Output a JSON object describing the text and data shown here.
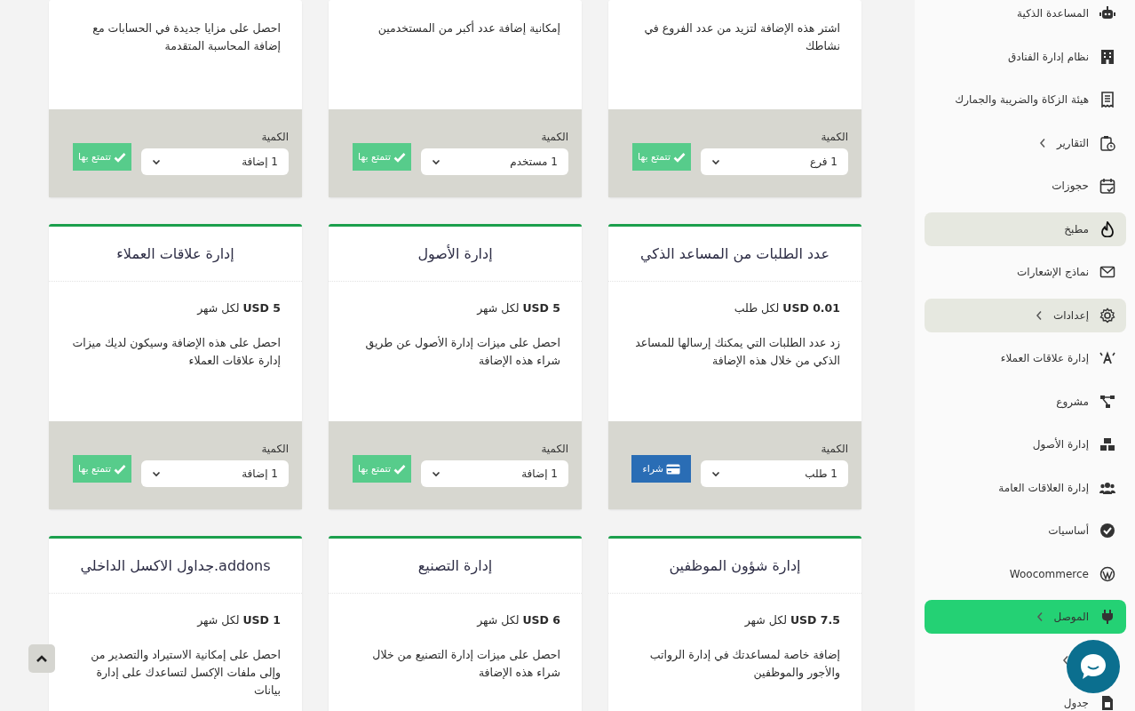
{
  "cards": [
    {
      "kind": "partial",
      "description": "اشتر هذه الإضافة لتزيد من عدد الفروع في نشاطك",
      "quantity_label": "الكمية",
      "quantity": "1 فرع",
      "button": {
        "kind": "owned",
        "label": "تتمتع بها"
      }
    },
    {
      "kind": "partial",
      "description": "إمكانية إضافة عدد أكبر من المستخدمين",
      "quantity_label": "الكمية",
      "quantity": "1 مستخدم",
      "button": {
        "kind": "owned",
        "label": "تتمتع بها"
      }
    },
    {
      "kind": "partial",
      "description": "احصل على مزايا جديدة في الحسابات مع إضافة المحاسبة المتقدمة",
      "quantity_label": "الكمية",
      "quantity": "1 إضافة",
      "button": {
        "kind": "owned",
        "label": "تتمتع بها"
      }
    },
    {
      "kind": "full",
      "title": "عدد الطلبات من المساعد الذكي",
      "price": "**USD 0.01** لكل طلب",
      "description": "زد عدد الطلبات التي يمكنك إرسالها للمساعد الذكي من خلال هذه الإضافة",
      "quantity_label": "الكمية",
      "quantity": "1 طلب",
      "button": {
        "kind": "buy",
        "label": "شراء"
      }
    },
    {
      "kind": "full",
      "title": "إدارة الأصول",
      "price": "**USD 5** لكل شهر",
      "description": "احصل على ميزات إدارة الأصول عن طريق شراء هذه الإضافة",
      "quantity_label": "الكمية",
      "quantity": "1 إضافة",
      "button": {
        "kind": "owned",
        "label": "تتمتع بها"
      }
    },
    {
      "kind": "full",
      "title": "إدارة علاقات العملاء",
      "price": "**USD 5** لكل شهر",
      "description": "احصل على هذه الإضافة وسيكون لديك ميزات إدارة علاقات العملاء",
      "quantity_label": "الكمية",
      "quantity": "1 إضافة",
      "button": {
        "kind": "owned",
        "label": "تتمتع بها"
      }
    },
    {
      "kind": "open",
      "title": "إدارة شؤون الموظفين",
      "price": "**USD 7.5** لكل شهر",
      "description": "إضافة خاصة لمساعدتك في إدارة الرواتب والأجور والموظفين"
    },
    {
      "kind": "open",
      "title": "إدارة التصنيع",
      "price": "**USD 6** لكل شهر",
      "description": "احصل على ميزات إدارة التصنيع من خلال شراء هذه الإضافة"
    },
    {
      "kind": "open",
      "title": "addons.جداول الاكسل الداخلي",
      "price": "**USD 1** لكل شهر",
      "description": "احصل على إمكانية الاستيراد والتصدير من وإلى ملفات الإكسل لتساعدك على إدارة بيانات"
    }
  ],
  "sidebar": {
    "items": [
      {
        "label": "المساعدة الذكية",
        "expandable": false,
        "selected": false,
        "hovered": false
      },
      {
        "label": "نظام إدارة الفنادق",
        "expandable": false,
        "selected": false,
        "hovered": false
      },
      {
        "label": "هيئة الزكاة والضريبة والجمارك",
        "expandable": false,
        "selected": false,
        "hovered": false
      },
      {
        "label": "التقارير",
        "expandable": true,
        "selected": false,
        "hovered": false
      },
      {
        "label": "حجوزات",
        "expandable": false,
        "selected": false,
        "hovered": false
      },
      {
        "label": "مطبخ",
        "expandable": false,
        "selected": false,
        "hovered": true
      },
      {
        "label": "نماذج الإشعارات",
        "expandable": false,
        "selected": false,
        "hovered": false
      },
      {
        "label": "إعدادات",
        "expandable": true,
        "selected": false,
        "hovered": true
      },
      {
        "label": "إدارة علاقات العملاء",
        "expandable": false,
        "selected": false,
        "hovered": false
      },
      {
        "label": "مشروع",
        "expandable": false,
        "selected": false,
        "hovered": false
      },
      {
        "label": "إدارة الأصول",
        "expandable": false,
        "selected": false,
        "hovered": false
      },
      {
        "label": "إدارة العلاقات العامة",
        "expandable": false,
        "selected": false,
        "hovered": false
      },
      {
        "label": "أساسيات",
        "expandable": false,
        "selected": false,
        "hovered": false
      },
      {
        "label": "Woocommerce",
        "expandable": false,
        "selected": false,
        "hovered": false
      },
      {
        "label": "الموصل",
        "expandable": true,
        "selected": true,
        "hovered": false
      },
      {
        "expandable": true,
        "selected": false,
        "hovered": false
      },
      {
        "label": "جدول",
        "expandable": false,
        "selected": false,
        "hovered": false
      }
    ]
  }
}
